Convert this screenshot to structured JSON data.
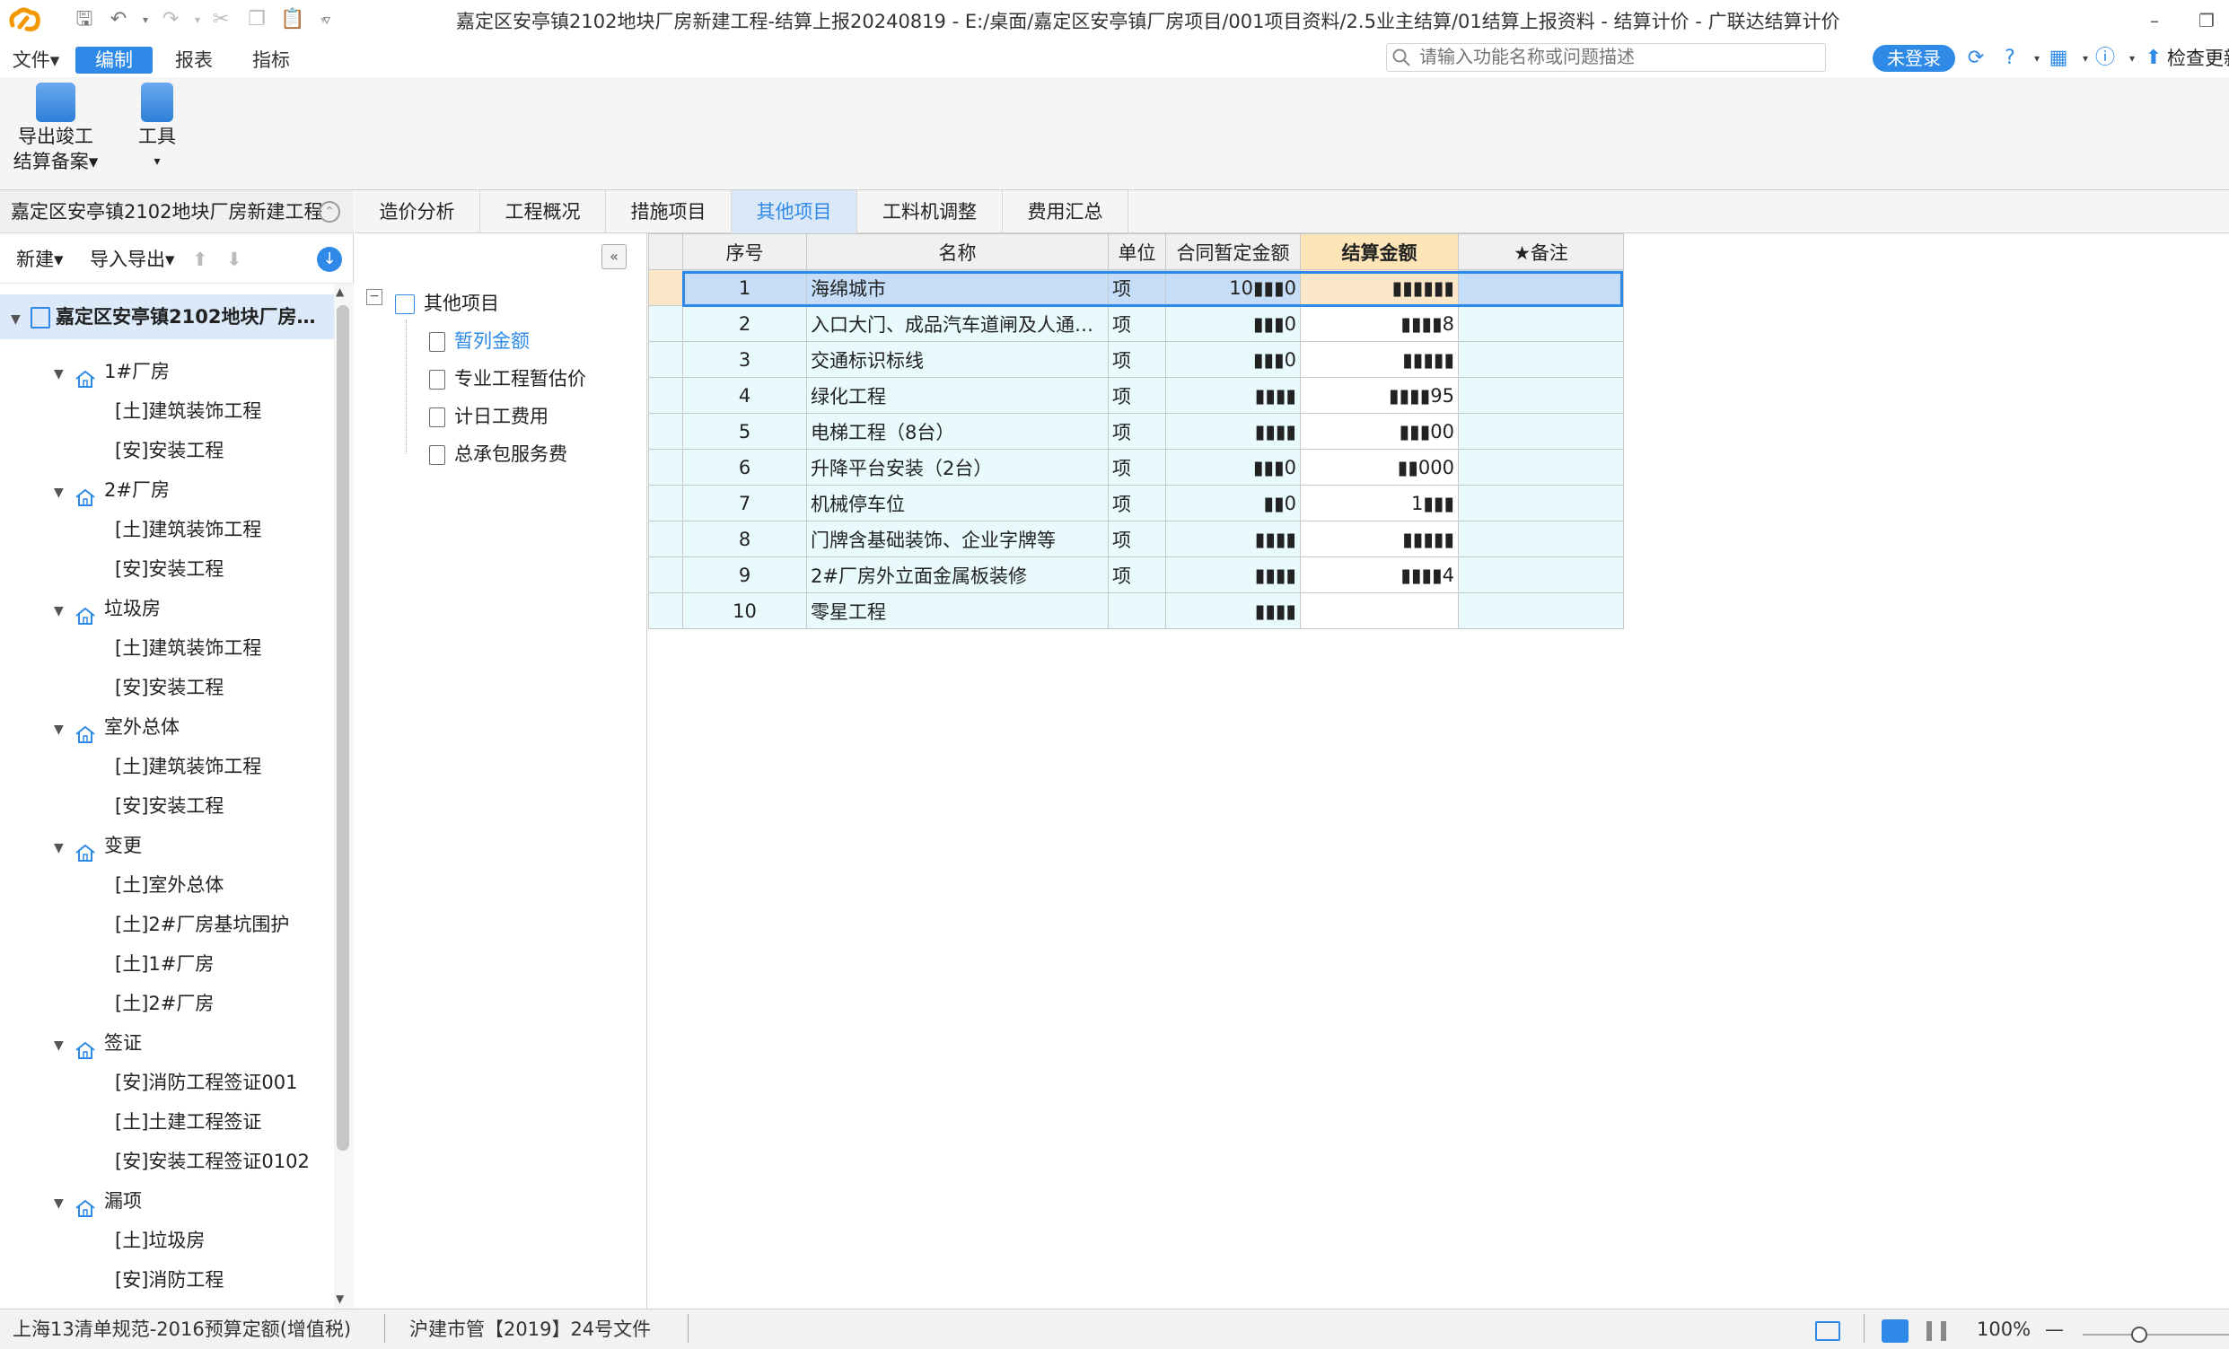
{
  "window": {
    "title": "嘉定区安亭镇2102地块厂房新建工程-结算上报20240819 - E:/桌面/嘉定区安亭镇厂房项目/001项目资料/2.5业主结算/01结算上报资料 - 结算计价 - 广联达结算计价",
    "min_glyph": "–",
    "max_glyph": "❐"
  },
  "menu": {
    "file": "文件▾",
    "edit": "编制",
    "report": "报表",
    "index": "指标"
  },
  "search": {
    "placeholder": "请输入功能名称或问题描述"
  },
  "account": {
    "login": "未登录",
    "check_update": "检查更新"
  },
  "ribbon": {
    "export_label_1": "导出竣工",
    "export_label_2": "结算备案▾",
    "tools_label": "工具",
    "tools_caret": "▾"
  },
  "left_panel": {
    "project_name": "嘉定区安亭镇2102地块厂房新建工程",
    "new_label": "新建▾",
    "import_export_label": "导入导出▾",
    "tree": [
      {
        "label": "嘉定区安亭镇2102地块厂房…",
        "level": 0
      },
      {
        "label": "1#厂房",
        "level": 1
      },
      {
        "label": "[土]建筑装饰工程",
        "level": 2
      },
      {
        "label": "[安]安装工程",
        "level": 2
      },
      {
        "label": "2#厂房",
        "level": 1
      },
      {
        "label": "[土]建筑装饰工程",
        "level": 2
      },
      {
        "label": "[安]安装工程",
        "level": 2
      },
      {
        "label": "垃圾房",
        "level": 1
      },
      {
        "label": "[土]建筑装饰工程",
        "level": 2
      },
      {
        "label": "[安]安装工程",
        "level": 2
      },
      {
        "label": "室外总体",
        "level": 1
      },
      {
        "label": "[土]建筑装饰工程",
        "level": 2
      },
      {
        "label": "[安]安装工程",
        "level": 2
      },
      {
        "label": "变更",
        "level": 1
      },
      {
        "label": "[土]室外总体",
        "level": 2
      },
      {
        "label": "[土]2#厂房基坑围护",
        "level": 2
      },
      {
        "label": "[土]1#厂房",
        "level": 2
      },
      {
        "label": "[土]2#厂房",
        "level": 2
      },
      {
        "label": "签证",
        "level": 1
      },
      {
        "label": "[安]消防工程签证001",
        "level": 2
      },
      {
        "label": "[土]土建工程签证",
        "level": 2
      },
      {
        "label": "[安]安装工程签证0102",
        "level": 2
      },
      {
        "label": "漏项",
        "level": 1
      },
      {
        "label": "[土]垃圾房",
        "level": 2
      },
      {
        "label": "[安]消防工程",
        "level": 2
      },
      {
        "label": "[安]充电桩工程",
        "level": 2
      }
    ]
  },
  "tabs": [
    "造价分析",
    "工程概况",
    "措施项目",
    "其他项目",
    "工料机调整",
    "费用汇总"
  ],
  "other_tree": {
    "root": "其他项目",
    "items": [
      "暂列金额",
      "专业工程暂估价",
      "计日工费用",
      "总承包服务费"
    ]
  },
  "grid": {
    "headers": [
      "序号",
      "名称",
      "单位",
      "合同暂定金额",
      "结算金额",
      "★备注"
    ],
    "rows": [
      {
        "no": "1",
        "name": "海绵城市",
        "unit": "项",
        "contract": "10▮▮▮0",
        "settle": "▮▮▮▮▮▮",
        "note": ""
      },
      {
        "no": "2",
        "name": "入口大门、成品汽车道闸及人通…",
        "unit": "项",
        "contract": "▮▮▮0",
        "settle": "▮▮▮▮8",
        "note": ""
      },
      {
        "no": "3",
        "name": "交通标识标线",
        "unit": "项",
        "contract": "▮▮▮0",
        "settle": "▮▮▮▮▮",
        "note": ""
      },
      {
        "no": "4",
        "name": "绿化工程",
        "unit": "项",
        "contract": "▮▮▮▮",
        "settle": "▮▮▮▮95",
        "note": ""
      },
      {
        "no": "5",
        "name": "电梯工程（8台）",
        "unit": "项",
        "contract": "▮▮▮▮",
        "settle": "▮▮▮00",
        "note": ""
      },
      {
        "no": "6",
        "name": "升降平台安装（2台）",
        "unit": "项",
        "contract": "▮▮▮0",
        "settle": "▮▮000",
        "note": ""
      },
      {
        "no": "7",
        "name": "机械停车位",
        "unit": "项",
        "contract": "▮▮0",
        "settle": "1▮▮▮",
        "note": ""
      },
      {
        "no": "8",
        "name": "门牌含基础装饰、企业字牌等",
        "unit": "项",
        "contract": "▮▮▮▮",
        "settle": "▮▮▮▮▮",
        "note": ""
      },
      {
        "no": "9",
        "name": "2#厂房外立面金属板装修",
        "unit": "项",
        "contract": "▮▮▮▮",
        "settle": "▮▮▮▮4",
        "note": ""
      },
      {
        "no": "10",
        "name": "零星工程",
        "unit": "",
        "contract": "▮▮▮▮",
        "settle": "",
        "note": ""
      }
    ]
  },
  "status": {
    "norm": "上海13清单规范-2016预算定额(增值税)",
    "doc": "沪建市管【2019】24号文件",
    "zoom": "100%",
    "zoom_minus": "—"
  },
  "colors": {
    "accent": "#2e8ae6",
    "selected_cell": "#fbe7c8",
    "row_bg": "#e8fafc"
  }
}
